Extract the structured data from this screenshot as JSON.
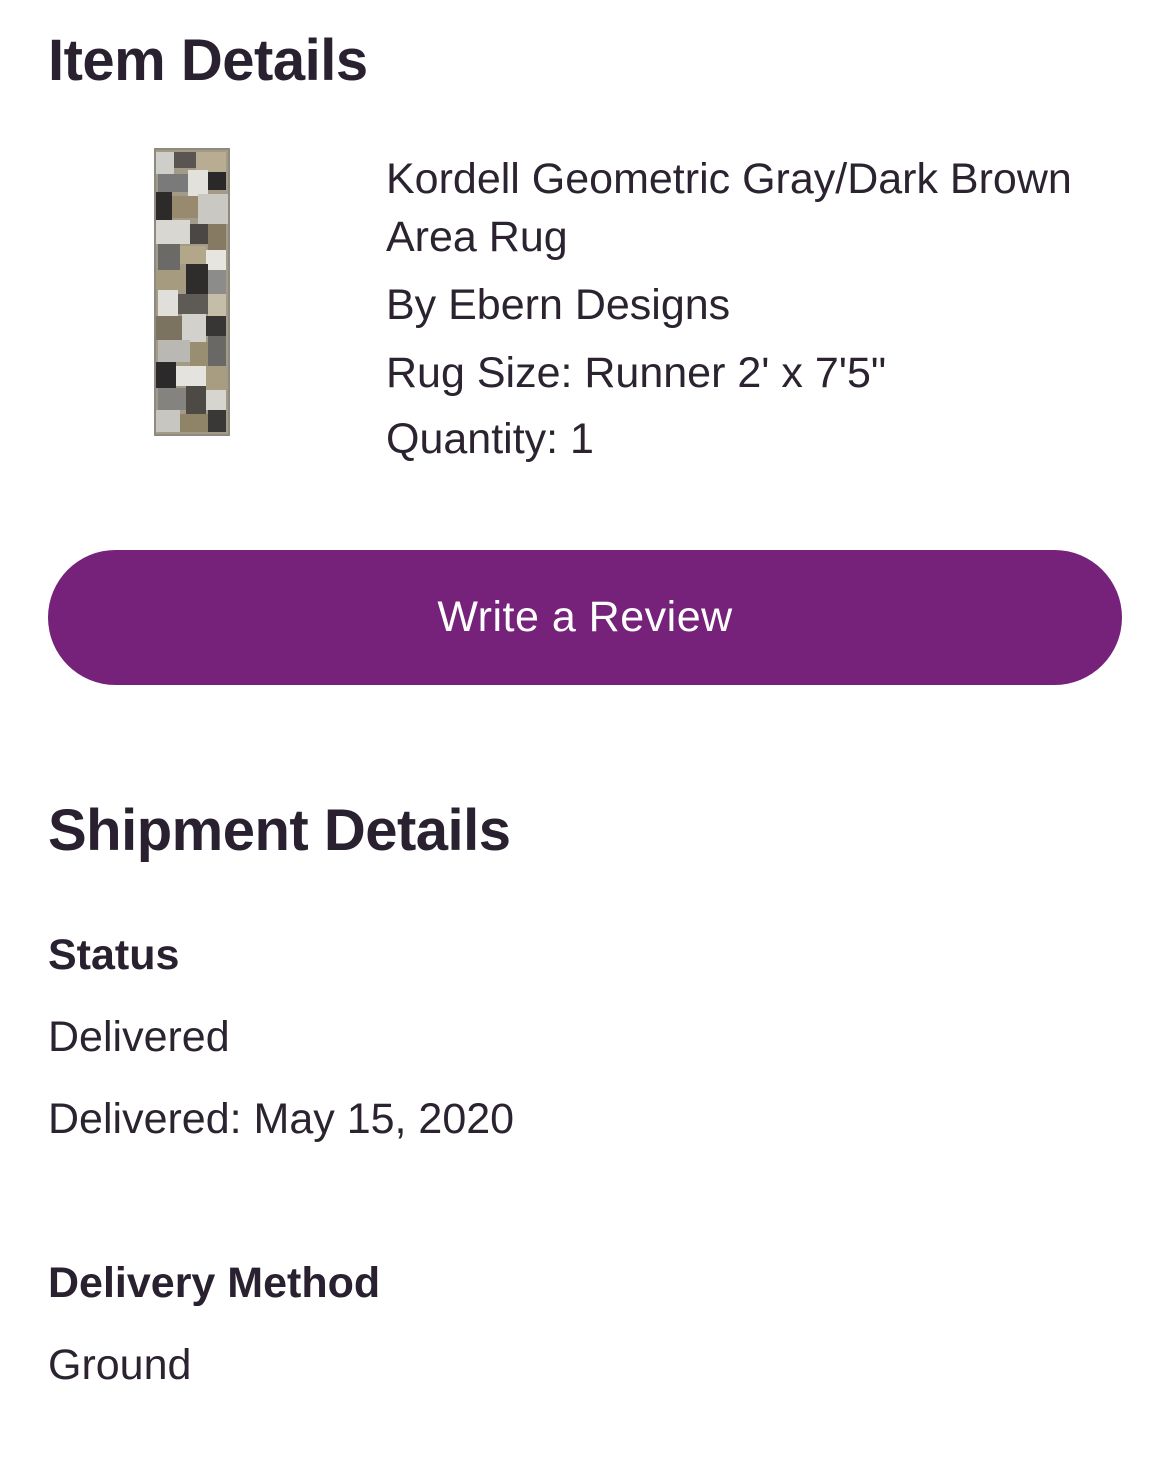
{
  "item_details": {
    "title": "Item Details",
    "product_name": "Kordell Geometric Gray/Dark Brown Area Rug",
    "brand": "By Ebern Designs",
    "rug_size": "Rug Size: Runner 2' x 7'5\"",
    "quantity": "Quantity: 1"
  },
  "review_button": {
    "label": "Write a Review",
    "color": "#76217a"
  },
  "shipment_details": {
    "title": "Shipment Details",
    "status_label": "Status",
    "status_value": "Delivered",
    "delivered_date": "Delivered: May 15, 2020",
    "delivery_method_label": "Delivery Method",
    "delivery_method_value": "Ground"
  }
}
